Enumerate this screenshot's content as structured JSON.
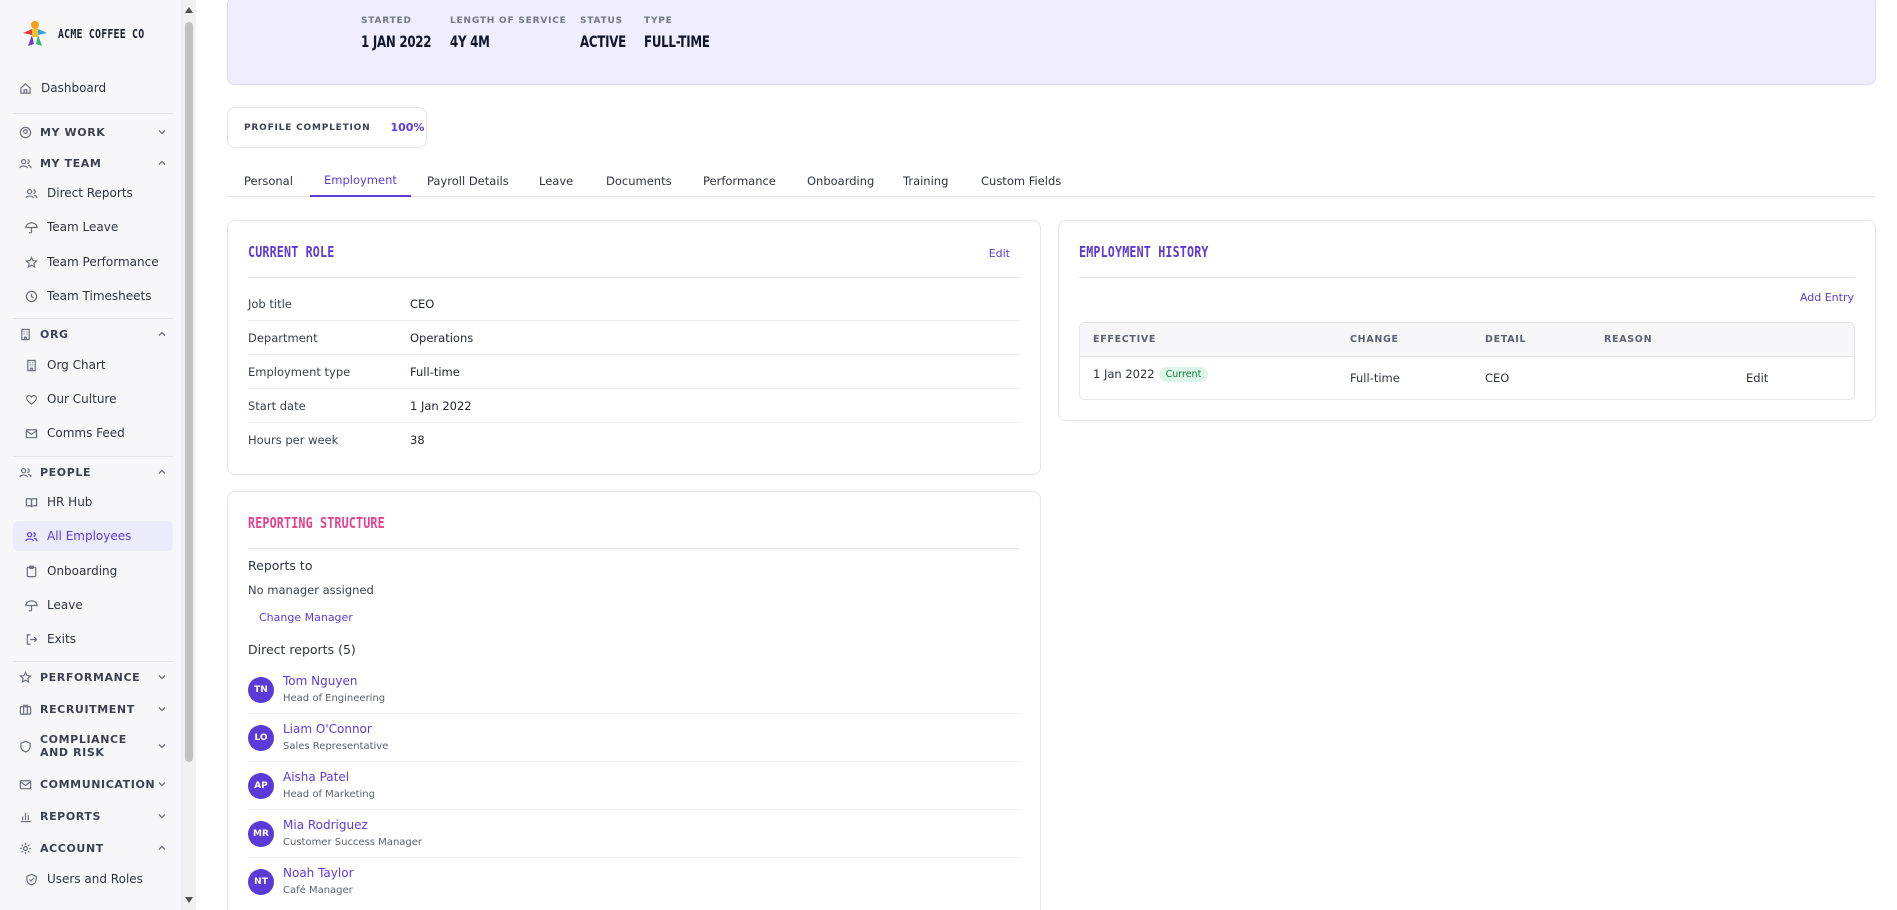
{
  "app": {
    "name": "ACME COFFEE CO"
  },
  "sidebar": {
    "dashboard": "Dashboard",
    "my_work": "MY WORK",
    "my_team": "MY TEAM",
    "team_items": [
      "Direct Reports",
      "Team Leave",
      "Team Performance",
      "Team Timesheets"
    ],
    "org": "ORG",
    "org_items": [
      "Org Chart",
      "Our Culture",
      "Comms Feed"
    ],
    "people": "PEOPLE",
    "people_items": [
      "HR Hub",
      "All Employees",
      "Onboarding",
      "Leave",
      "Exits"
    ],
    "performance": "PERFORMANCE",
    "recruitment": "RECRUITMENT",
    "compliance_1": "COMPLIANCE",
    "compliance_2": "AND RISK",
    "communication": "COMMUNICATION",
    "reports": "REPORTS",
    "account": "ACCOUNT",
    "account_items": [
      "Users and Roles"
    ]
  },
  "banner": {
    "started": {
      "label": "STARTED",
      "value": "1 JAN 2022"
    },
    "service": {
      "label": "LENGTH OF SERVICE",
      "value": "4Y 4M"
    },
    "status": {
      "label": "STATUS",
      "value": "ACTIVE"
    },
    "type": {
      "label": "TYPE",
      "value": "FULL-TIME"
    }
  },
  "profile_completion": {
    "label": "PROFILE COMPLETION",
    "value": "100%"
  },
  "tabs": [
    "Personal",
    "Employment",
    "Payroll Details",
    "Leave",
    "Documents",
    "Performance",
    "Onboarding",
    "Training",
    "Custom Fields"
  ],
  "active_tab": "Employment",
  "current_role": {
    "title": "CURRENT ROLE",
    "edit": "Edit",
    "fields": [
      {
        "label": "Job title",
        "value": "CEO"
      },
      {
        "label": "Department",
        "value": "Operations"
      },
      {
        "label": "Employment type",
        "value": "Full-time"
      },
      {
        "label": "Start date",
        "value": "1 Jan 2022"
      },
      {
        "label": "Hours per week",
        "value": "38"
      }
    ]
  },
  "reporting": {
    "title": "REPORTING STRUCTURE",
    "reports_to_label": "Reports to",
    "no_manager": "No manager assigned",
    "change_manager": "Change Manager",
    "direct_reports_label": "Direct reports (5)",
    "people": [
      {
        "initials": "TN",
        "name": "Tom Nguyen",
        "role": "Head of Engineering"
      },
      {
        "initials": "LO",
        "name": "Liam O'Connor",
        "role": "Sales Representative"
      },
      {
        "initials": "AP",
        "name": "Aisha Patel",
        "role": "Head of Marketing"
      },
      {
        "initials": "MR",
        "name": "Mia Rodriguez",
        "role": "Customer Success Manager"
      },
      {
        "initials": "NT",
        "name": "Noah Taylor",
        "role": "Café Manager"
      }
    ]
  },
  "history": {
    "title": "EMPLOYMENT HISTORY",
    "add_entry": "Add Entry",
    "headers": [
      "EFFECTIVE",
      "CHANGE",
      "DETAIL",
      "REASON"
    ],
    "rows": [
      {
        "effective": "1 Jan 2022",
        "badge": "Current",
        "change": "Full-time",
        "detail": "CEO",
        "reason": "",
        "edit": "Edit"
      }
    ]
  },
  "colors": {
    "accent": "#5b3bd8",
    "pink": "#e83e8c",
    "banner": "#efedfe"
  }
}
